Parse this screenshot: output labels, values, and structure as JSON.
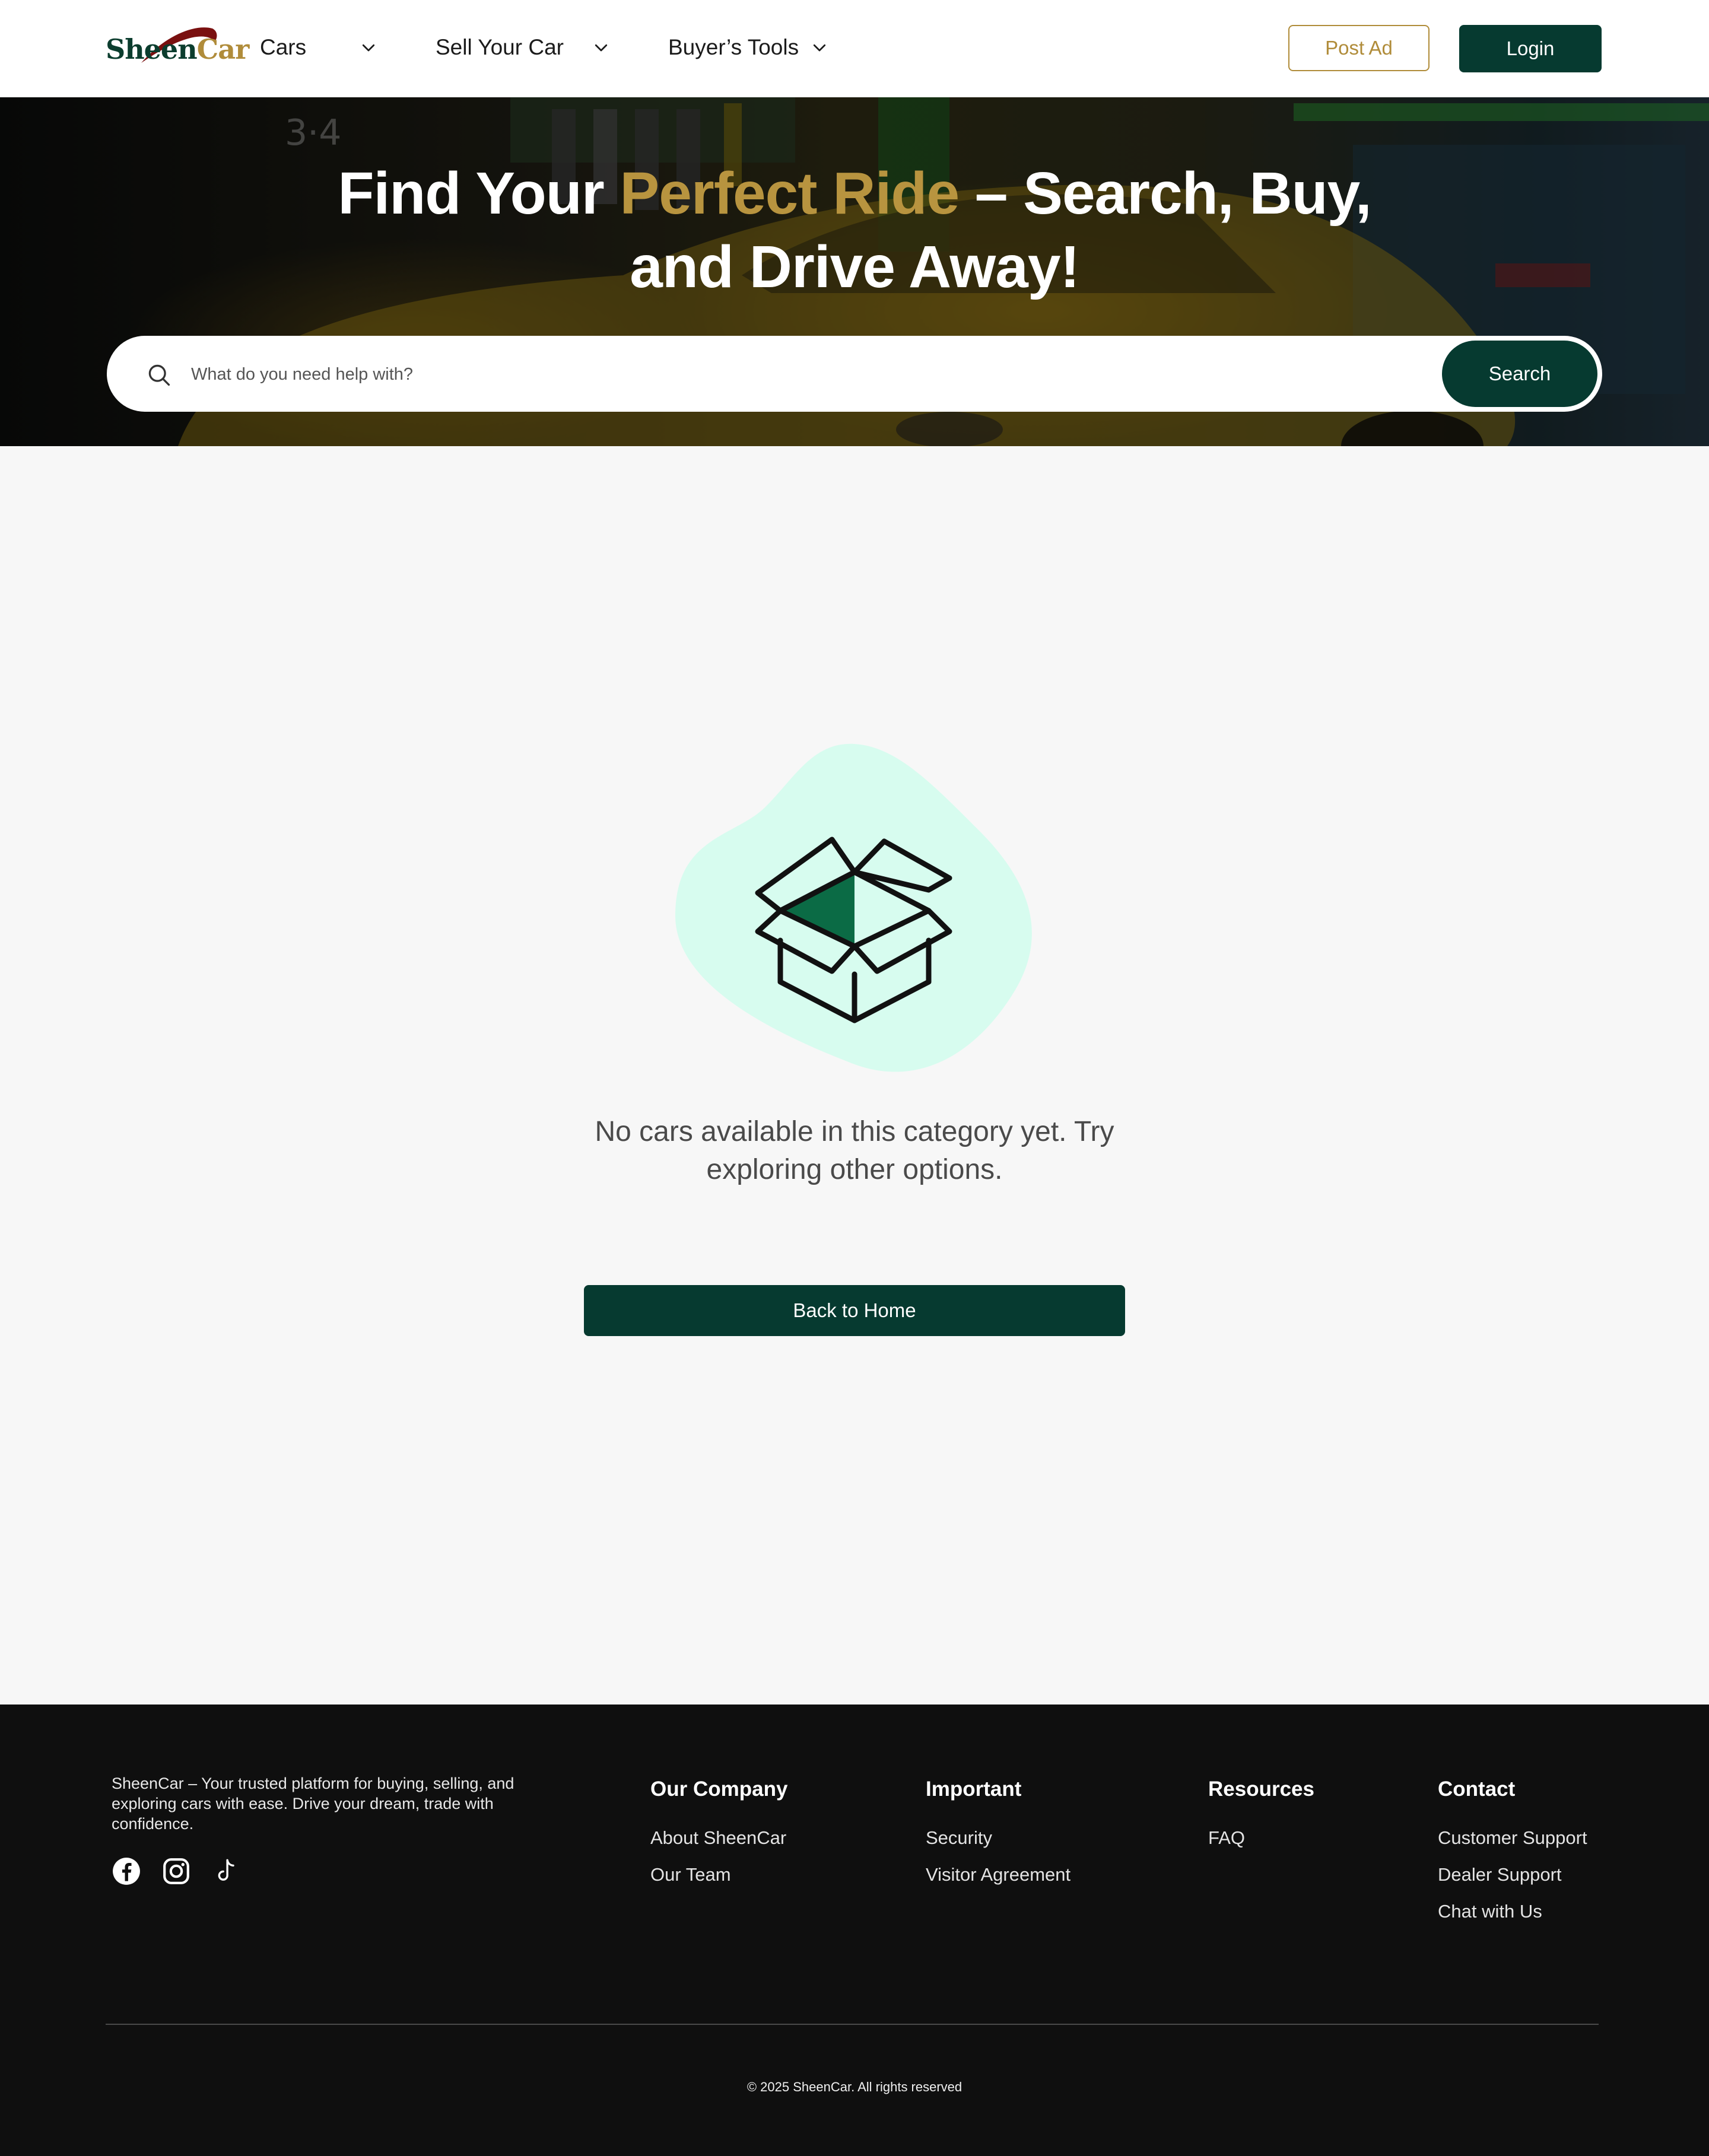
{
  "brand": {
    "name_part1": "Sheen",
    "name_part2": "Car",
    "colors": {
      "primary": "#063a30",
      "accent": "#b08c3a",
      "mint": "#d7fcef",
      "box_fill": "#0b6b45"
    }
  },
  "nav": {
    "items": [
      {
        "label": "Cars",
        "icon": "chevron-down-icon"
      },
      {
        "label": "Sell Your Car",
        "icon": "chevron-down-icon"
      },
      {
        "label": "Buyer’s Tools",
        "icon": "chevron-down-icon"
      }
    ],
    "post_ad_label": "Post Ad",
    "login_label": "Login"
  },
  "hero": {
    "title_start": "Find Your ",
    "title_accent": "Perfect Ride",
    "title_rest": " – Search, Buy,",
    "title_line2": "and Drive Away!",
    "search": {
      "placeholder": "What do you need help with?",
      "value": "",
      "button_label": "Search",
      "icon": "search-icon"
    }
  },
  "empty_state": {
    "icon": "open-box-icon",
    "message": "No cars available in this category yet. Try exploring other options.",
    "button_label": "Back to Home"
  },
  "footer": {
    "about": "SheenCar – Your trusted platform for buying, selling, and exploring cars with ease. Drive your dream, trade with confidence.",
    "socials": [
      "facebook-icon",
      "instagram-icon",
      "tiktok-icon"
    ],
    "columns": [
      {
        "title": "Our Company",
        "links": [
          "About SheenCar",
          "Our Team"
        ]
      },
      {
        "title": "Important",
        "links": [
          "Security",
          "Visitor Agreement"
        ]
      },
      {
        "title": "Resources",
        "links": [
          "FAQ"
        ]
      },
      {
        "title": "Contact",
        "links": [
          "Customer Support",
          "Dealer Support",
          "Chat with Us"
        ]
      }
    ],
    "copyright": "© 2025 SheenCar. All rights reserved"
  }
}
